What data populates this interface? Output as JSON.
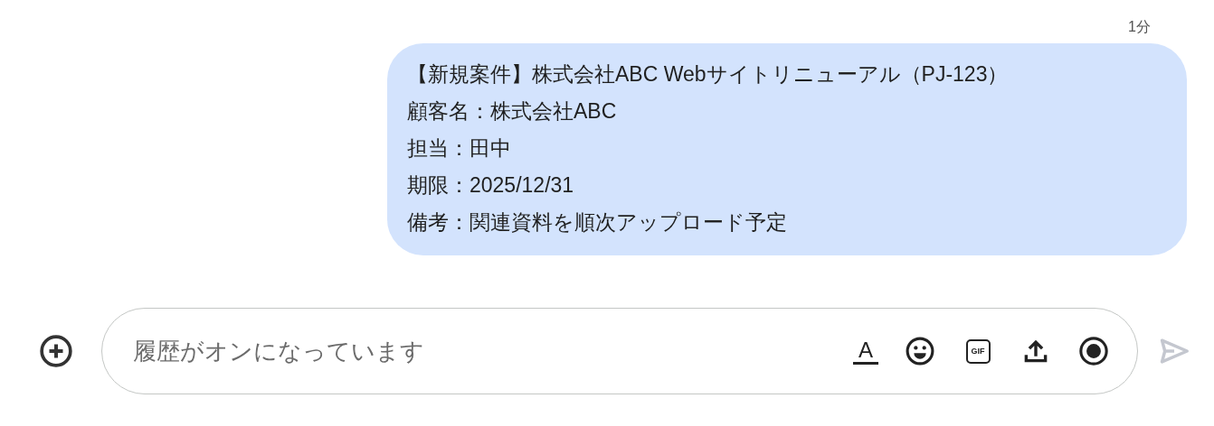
{
  "message": {
    "time": "1分",
    "lines": [
      "【新規案件】株式会社ABC Webサイトリニューアル（PJ-123）",
      "顧客名：株式会社ABC",
      "担当：田中",
      "期限：2025/12/31",
      "備考：関連資料を順次アップロード予定"
    ]
  },
  "composer": {
    "placeholder": "履歴がオンになっています",
    "tools": [
      {
        "kind": "format",
        "label": "A"
      },
      {
        "kind": "emoji"
      },
      {
        "kind": "gif",
        "label": "GIF"
      },
      {
        "kind": "upload"
      },
      {
        "kind": "record"
      }
    ],
    "send": {
      "disabled": true
    }
  }
}
